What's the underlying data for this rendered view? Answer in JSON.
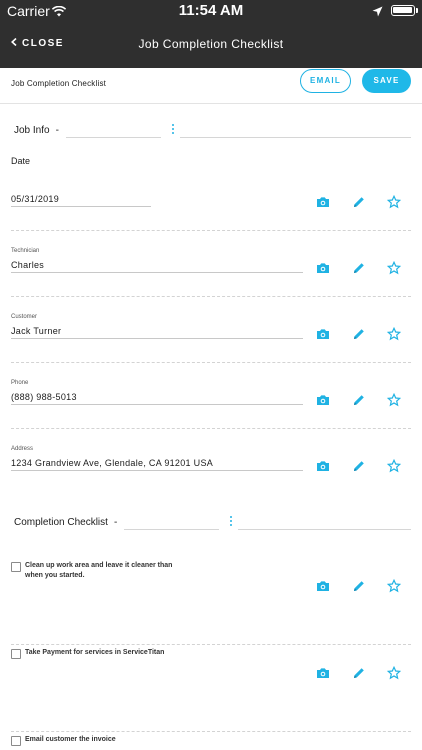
{
  "status_bar": {
    "carrier": "Carrier",
    "time": "11:54 AM"
  },
  "nav": {
    "close_label": "CLOSE",
    "title": "Job Completion Checklist"
  },
  "header": {
    "title": "Job Completion Checklist",
    "email_label": "EMAIL",
    "save_label": "SAVE"
  },
  "job_info": {
    "title": "Job Info",
    "dash": "-",
    "date_label": "Date"
  },
  "fields": [
    {
      "caption": "",
      "value": "05/31/2019"
    },
    {
      "caption": "Technician",
      "value": "Charles"
    },
    {
      "caption": "Customer",
      "value": "Jack Turner"
    },
    {
      "caption": "Phone",
      "value": "(888) 988-5013"
    },
    {
      "caption": "Address",
      "value": "1234 Grandview Ave, Glendale, CA 91201 USA"
    }
  ],
  "checklist": {
    "title": "Completion Checklist",
    "dash": "-",
    "items": [
      {
        "label": "Clean up work area and leave it cleaner than when you started.",
        "checked": false
      },
      {
        "label": "Take Payment for services in ServiceTitan",
        "checked": false
      },
      {
        "label": "Email customer the invoice",
        "checked": false
      }
    ]
  },
  "colors": {
    "accent": "#1fb2e3",
    "nav_bg": "#2f2f2f"
  },
  "icons": {
    "photo": "camera-icon",
    "edit": "pencil-icon",
    "favorite": "star-icon"
  }
}
